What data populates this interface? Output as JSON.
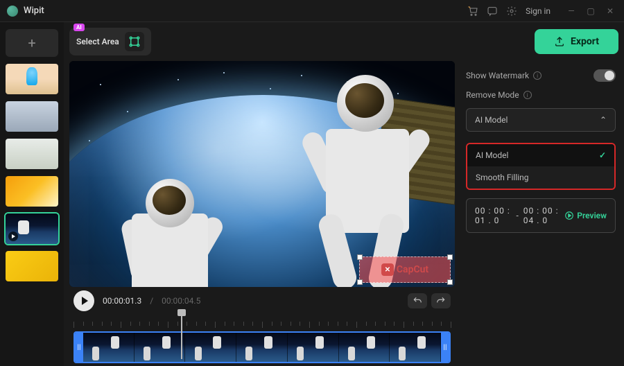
{
  "app": {
    "title": "Wipit"
  },
  "titlebar": {
    "signin": "Sign in"
  },
  "toolbar": {
    "select_area_label": "Select Area",
    "ai_badge": "AI",
    "export_label": "Export"
  },
  "sidebar": {
    "thumbs": [
      {
        "id": "ice-cream"
      },
      {
        "id": "living-room"
      },
      {
        "id": "tshirt"
      },
      {
        "id": "flowers-orange"
      },
      {
        "id": "astronaut",
        "active": true,
        "has_play_badge": true
      },
      {
        "id": "sunflowers"
      }
    ]
  },
  "canvas": {
    "watermark_text": "CapCut"
  },
  "transport": {
    "current_time": "00:00:01.3",
    "duration": "00:00:04.5"
  },
  "timeline": {
    "playhead_ratio": 0.29,
    "clip": {
      "frame_count": 7
    }
  },
  "right_panel": {
    "show_watermark_label": "Show Watermark",
    "show_watermark_on": false,
    "remove_mode_label": "Remove Mode",
    "dropdown": {
      "selected": "AI Model",
      "options": [
        "AI Model",
        "Smooth Filling"
      ]
    },
    "time_range": {
      "start": "00 : 00 : 01 . 0",
      "sep": "-",
      "end": "00 : 00 : 04 . 0"
    },
    "preview_label": "Preview"
  }
}
